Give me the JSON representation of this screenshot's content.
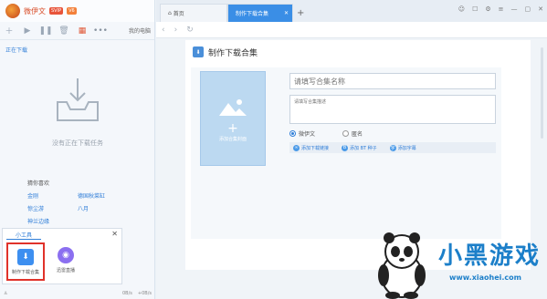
{
  "user": {
    "name": "微伊文",
    "vip_badge": "SVIP",
    "level_badge": "V6"
  },
  "toolbar": {
    "pc_label": "我的电脑"
  },
  "sidebar": {
    "section_title": "正在下载",
    "empty_text": "没有正在下载任务",
    "recommend_title": "猜你喜欢",
    "recommend_links": [
      "金刚",
      "德国秋菜缸",
      "惊尘游",
      "八月",
      "神兰边缘"
    ]
  },
  "tools": {
    "tab": "小工具",
    "items": [
      {
        "label": "制作下载合集"
      },
      {
        "label": "迅雷直播"
      }
    ]
  },
  "status": {
    "left": "0B/s",
    "right": "+0B/s"
  },
  "tabs": [
    {
      "label": "首页"
    },
    {
      "label": "制作下载合集"
    }
  ],
  "page": {
    "title": "制作下载合集",
    "cover_label": "添加合集封面",
    "name_placeholder": "请填写合集名称",
    "desc_placeholder": "请填写合集描述",
    "radio_options": [
      "微伊文",
      "匿名"
    ],
    "add_buttons": [
      "添加下载链接",
      "添加 BT 种子",
      "添加字幕"
    ]
  },
  "watermark": {
    "text": "小黑游戏",
    "url": "www.xiaohei.com"
  },
  "colors": {
    "accent": "#3a8ee6",
    "link": "#2f7ed8",
    "brand_red": "#e05a3a"
  }
}
